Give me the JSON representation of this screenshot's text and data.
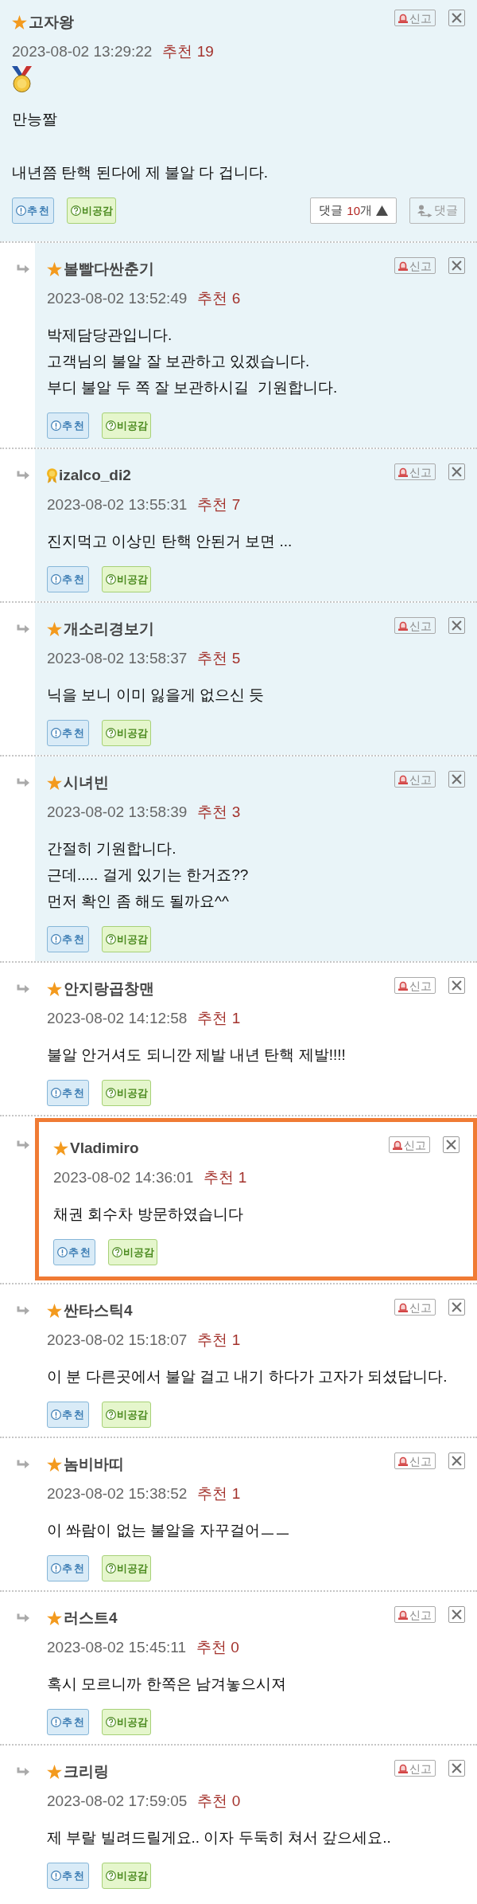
{
  "post_comment": {
    "author": "고자왕",
    "badge": {
      "kind": "star"
    },
    "timestamp": "2023-08-02 13:29:22",
    "score": "추천 19",
    "medal": true,
    "tinted": true,
    "paragraphs": [
      "만능짤",
      "내년쯤 탄핵 된다에 제 불알 다 겁니다."
    ],
    "report": "신고",
    "like": "추천",
    "dislike": "비공감",
    "replies_toggle": {
      "label": "댓글",
      "count": "10",
      "unit": "개",
      "expanded": true
    },
    "reply_button": "댓글"
  },
  "replies": [
    {
      "author": "볼빨다싼춘기",
      "badge": {
        "kind": "star"
      },
      "timestamp": "2023-08-02 13:52:49",
      "score": "추천 6",
      "tinted": true,
      "outlined": false,
      "lines": [
        "박제담당관입니다.",
        "고객님의 불알 잘 보관하고 있겠습니다.",
        "부디 불알 두 쪽 잘 보관하시길  기원합니다."
      ],
      "report": "신고",
      "like": "추천",
      "dislike": "비공감"
    },
    {
      "author": "izalco_di2",
      "badge": {
        "kind": "ribbon"
      },
      "timestamp": "2023-08-02 13:55:31",
      "score": "추천 7",
      "tinted": true,
      "outlined": false,
      "lines": [
        "진지먹고 이상민 탄핵 안된거 보면 ..."
      ],
      "report": "신고",
      "like": "추천",
      "dislike": "비공감"
    },
    {
      "author": "개소리경보기",
      "badge": {
        "kind": "star"
      },
      "timestamp": "2023-08-02 13:58:37",
      "score": "추천 5",
      "tinted": true,
      "outlined": false,
      "lines": [
        "닉을 보니 이미 잃을게 없으신 듯"
      ],
      "report": "신고",
      "like": "추천",
      "dislike": "비공감"
    },
    {
      "author": "시녀빈",
      "badge": {
        "kind": "star"
      },
      "timestamp": "2023-08-02 13:58:39",
      "score": "추천 3",
      "tinted": true,
      "outlined": false,
      "lines": [
        "간절히 기원합니다.",
        "근데..... 걸게 있기는 한거죠??",
        "먼저 확인 좀 해도 될까요^^"
      ],
      "report": "신고",
      "like": "추천",
      "dislike": "비공감"
    },
    {
      "author": "안지랑곱창맨",
      "badge": {
        "kind": "star"
      },
      "timestamp": "2023-08-02 14:12:58",
      "score": "추천 1",
      "tinted": false,
      "outlined": false,
      "lines": [
        "불알 안거셔도 되니깐 제발 내년 탄핵 제발!!!!"
      ],
      "report": "신고",
      "like": "추천",
      "dislike": "비공감"
    },
    {
      "author": "Vladimiro",
      "badge": {
        "kind": "star"
      },
      "timestamp": "2023-08-02 14:36:01",
      "score": "추천 1",
      "tinted": false,
      "outlined": true,
      "lines": [
        "채권 회수차 방문하였습니다"
      ],
      "report": "신고",
      "like": "추천",
      "dislike": "비공감"
    },
    {
      "author": "싼타스틱4",
      "badge": {
        "kind": "star"
      },
      "timestamp": "2023-08-02 15:18:07",
      "score": "추천 1",
      "tinted": false,
      "outlined": false,
      "lines": [
        "이 분 다른곳에서 불알 걸고 내기 하다가 고자가 되셨답니다."
      ],
      "report": "신고",
      "like": "추천",
      "dislike": "비공감"
    },
    {
      "author": "놈비바띠",
      "badge": {
        "kind": "star"
      },
      "timestamp": "2023-08-02 15:38:52",
      "score": "추천 1",
      "tinted": false,
      "outlined": false,
      "lines": [
        "이 쏴람이 없는 불알을 자꾸걸어ㅡㅡ"
      ],
      "report": "신고",
      "like": "추천",
      "dislike": "비공감"
    },
    {
      "author": "러스트4",
      "badge": {
        "kind": "star"
      },
      "timestamp": "2023-08-02 15:45:11",
      "score": "추천 0",
      "tinted": false,
      "outlined": false,
      "lines": [
        "혹시 모르니까 한쪽은 남겨놓으시져"
      ],
      "report": "신고",
      "like": "추천",
      "dislike": "비공감"
    },
    {
      "author": "크리링",
      "badge": {
        "kind": "star"
      },
      "timestamp": "2023-08-02 17:59:05",
      "score": "추천 0",
      "tinted": false,
      "outlined": false,
      "lines": [
        "제 부랄 빌려드릴게요.. 이자 두둑히 쳐서 갚으세요.."
      ],
      "report": "신고",
      "like": "추천",
      "dislike": "비공감"
    }
  ]
}
